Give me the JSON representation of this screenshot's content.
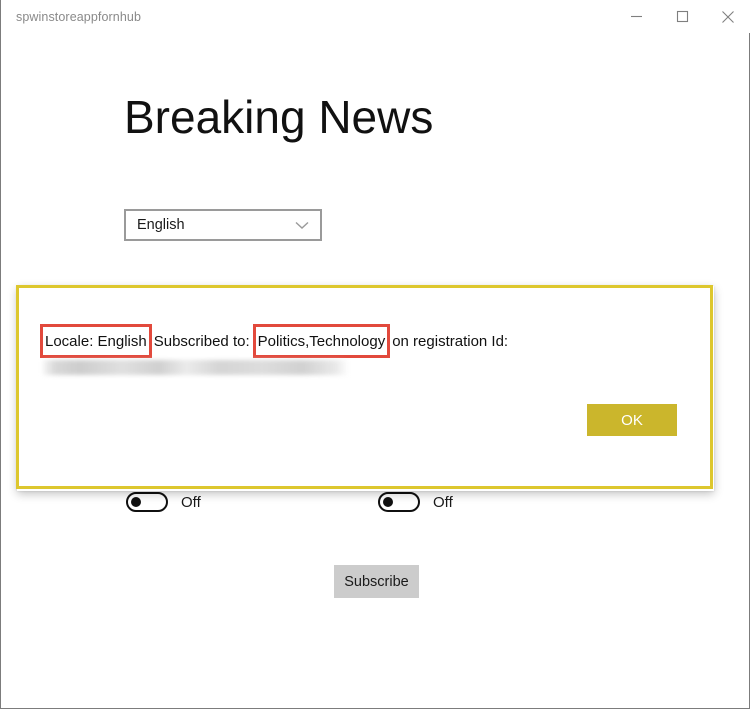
{
  "window": {
    "title": "spwinstoreappfornhub",
    "controls": {
      "minimize": "minimize-button",
      "maximize": "maximize-button",
      "close": "close-button"
    }
  },
  "page": {
    "heading": "Breaking News"
  },
  "locale_select": {
    "selected": "English",
    "chevron": "chevron-down-icon"
  },
  "toggles": [
    {
      "label": "Off",
      "state": "off"
    },
    {
      "label": "Off",
      "state": "off"
    }
  ],
  "actions": {
    "subscribe_label": "Subscribe"
  },
  "dialog": {
    "text_parts": {
      "locale": "Locale: English",
      "subscribed_to_label": "Subscribed to:",
      "topics": "Politics,Technology",
      "registration_suffix": "on registration Id:"
    },
    "registration_id": "",
    "ok_label": "OK"
  },
  "colors": {
    "dialog_border": "#ddc72e",
    "ok_button": "#cbb62c",
    "annotation_box": "#e2493c",
    "subscribe_button": "#cccccc",
    "window_border": "#7c7c7c",
    "title_text": "#8a8a8a"
  }
}
